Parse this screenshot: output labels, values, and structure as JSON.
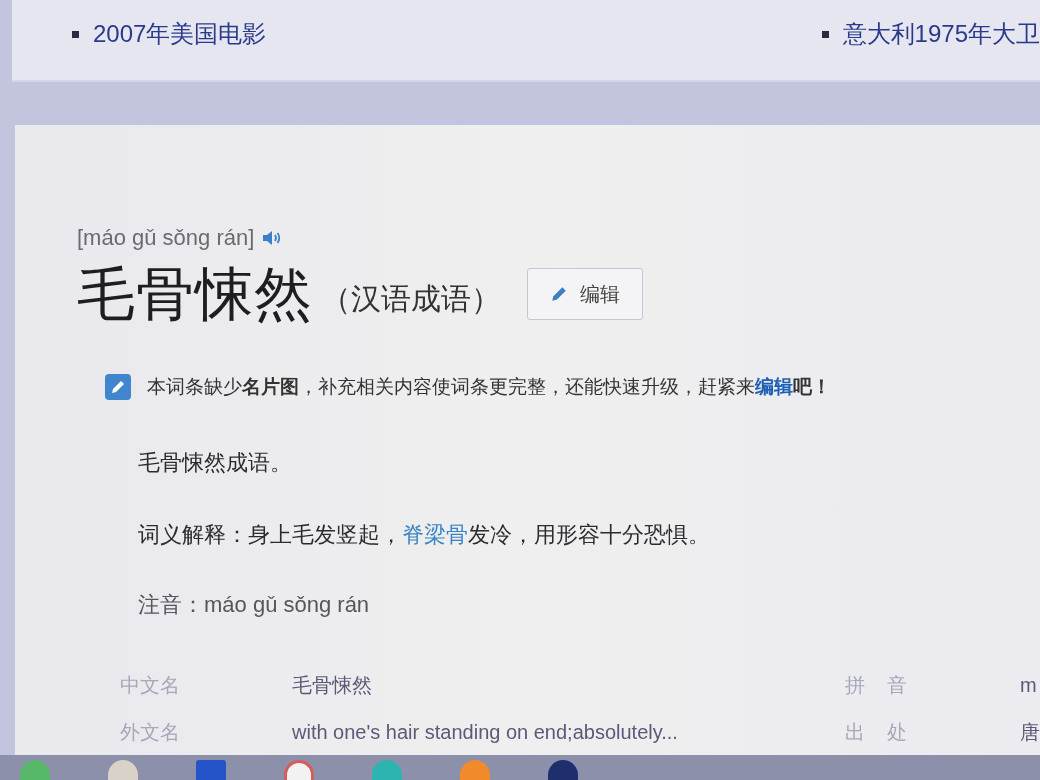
{
  "related_panel": {
    "items": [
      "2007年美国电影",
      "意大利1975年大卫"
    ]
  },
  "entry": {
    "pinyin": "[máo gǔ sǒng rán]",
    "title": "毛骨悚然",
    "subtitle": "（汉语成语）",
    "edit_button": "编辑"
  },
  "notice": {
    "segments": [
      {
        "kind": "text",
        "text": "本词条缺少**名片图**，补充相关内容使词条更完整，还能快速升级，赶紧来"
      },
      {
        "kind": "link",
        "text": "编辑"
      },
      {
        "kind": "text",
        "text": "**吧！**"
      }
    ]
  },
  "paragraphs": [
    {
      "segments": [
        {
          "kind": "text",
          "text": "毛骨悚然成语。"
        }
      ]
    },
    {
      "segments": [
        {
          "kind": "text",
          "text": "词义解释：身上毛发竖起，"
        },
        {
          "kind": "link",
          "text": "脊梁骨"
        },
        {
          "kind": "text",
          "text": "发冷，用形容十分恐惧。"
        }
      ]
    },
    {
      "segments": [
        {
          "kind": "text",
          "text": "注音：máo gǔ sǒng rán"
        }
      ]
    }
  ],
  "basic_info": {
    "rows": [
      {
        "cells": [
          {
            "label": "中文名",
            "value": "毛骨悚然"
          },
          {
            "label": "拼 音",
            "value": "m"
          }
        ]
      },
      {
        "cells": [
          {
            "label": "外文名",
            "value": "with one's hair standing on end;absolutely..."
          },
          {
            "label": "出 处",
            "value": "唐"
          }
        ]
      }
    ]
  }
}
